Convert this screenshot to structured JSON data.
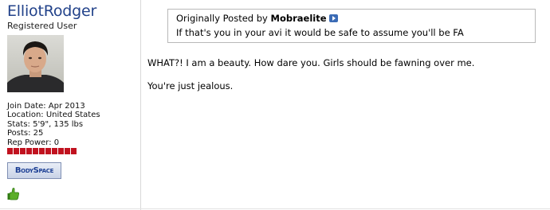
{
  "user": {
    "name": "ElliotRodger",
    "title": "Registered User",
    "join_date": "Join Date: Apr 2013",
    "location": "Location: United States",
    "stats": "Stats: 5'9\", 135 lbs",
    "posts": "Posts: 25",
    "rep_power": "Rep Power: 0",
    "rep_bar_segments": 11,
    "rep_color": "#c1121f",
    "bodyspace_label": "BodySpace",
    "rep_icon": "rep-hand-icon"
  },
  "quote": {
    "prefix": "Originally Posted by",
    "author": "Mobraelite",
    "view_icon": "view-post-icon",
    "text": "If that's you in your avi it would be safe to assume you'll be FA"
  },
  "message": {
    "line1": "WHAT?! I am a beauty. How dare you. Girls should be fawning over me.",
    "line2": "You're just jealous."
  },
  "colors": {
    "username": "#22428a",
    "border": "#b9b9b9"
  }
}
